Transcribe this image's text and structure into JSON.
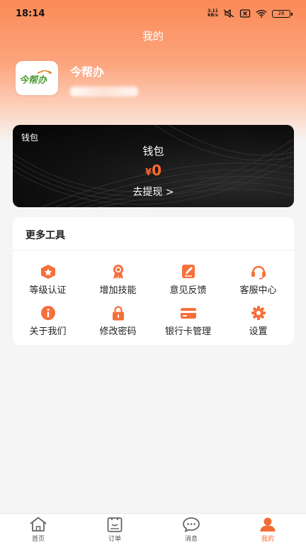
{
  "status_bar": {
    "time": "18:14",
    "net_speed": "3.11",
    "net_unit": "KB/s",
    "battery": "28"
  },
  "header": {
    "title": "我的"
  },
  "profile": {
    "name": "今帮办",
    "logo_text": "今帮办"
  },
  "wallet": {
    "tag": "钱包",
    "title": "钱包",
    "currency": "¥",
    "amount": "0",
    "withdraw": "去提现 >"
  },
  "tools": {
    "title": "更多工具",
    "items": [
      {
        "label": "等级认证",
        "icon": "level-badge-icon"
      },
      {
        "label": "增加技能",
        "icon": "skill-medal-icon"
      },
      {
        "label": "意见反馈",
        "icon": "feedback-edit-icon"
      },
      {
        "label": "客服中心",
        "icon": "headset-icon"
      },
      {
        "label": "关于我们",
        "icon": "info-icon"
      },
      {
        "label": "修改密码",
        "icon": "lock-icon"
      },
      {
        "label": "银行卡管理",
        "icon": "bank-card-icon"
      },
      {
        "label": "设置",
        "icon": "gear-icon"
      }
    ]
  },
  "tabbar": {
    "items": [
      {
        "label": "首页",
        "icon": "home-icon"
      },
      {
        "label": "订单",
        "icon": "order-icon"
      },
      {
        "label": "消息",
        "icon": "message-icon"
      },
      {
        "label": "我的",
        "icon": "profile-icon",
        "active": true
      }
    ]
  },
  "colors": {
    "accent": "#f26b35",
    "icon_orange": "#f5703a",
    "wallet_amount": "#ff6a2e"
  }
}
